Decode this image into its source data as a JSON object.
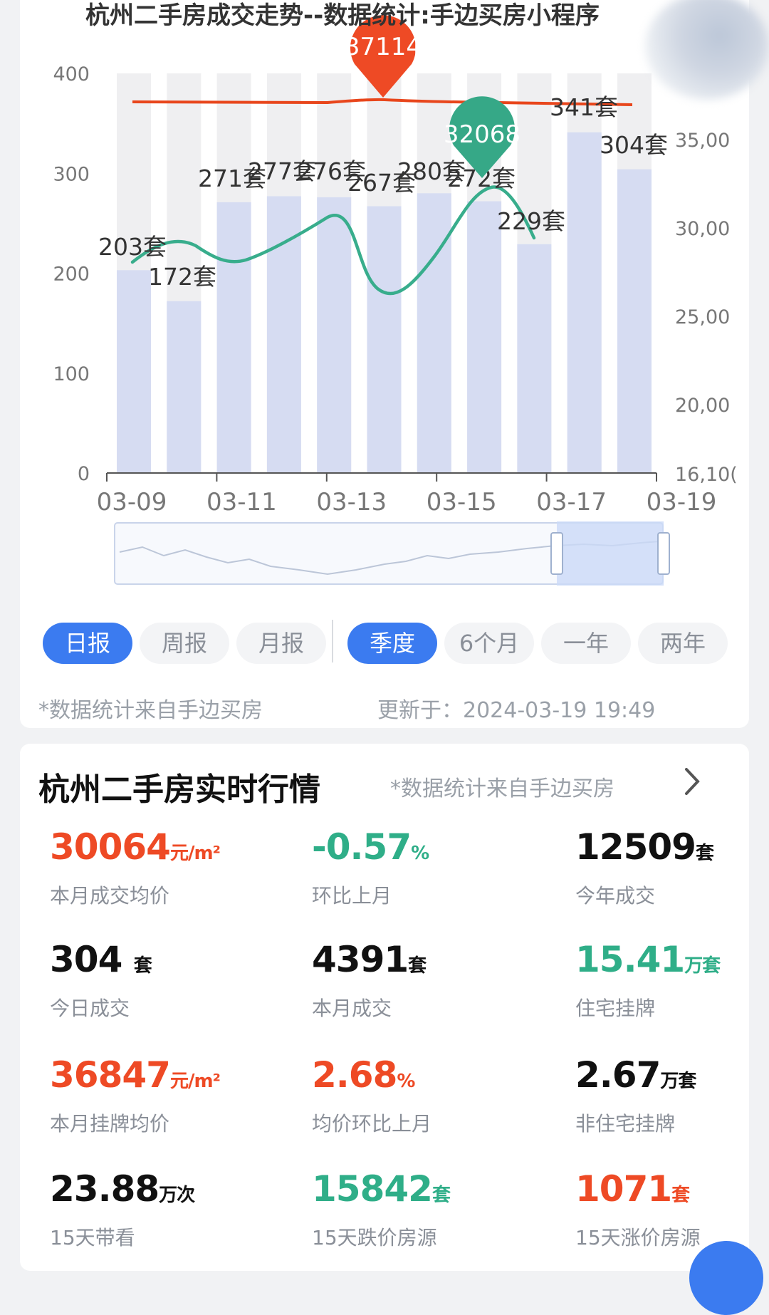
{
  "chart": {
    "title": "杭州二手房成交走势--数据统计:手边买房小程序",
    "left_ticks": [
      "400",
      "300",
      "200",
      "100",
      "0"
    ],
    "right_ticks": [
      "35,00",
      "30,00",
      "25,00",
      "20,00",
      "16,10("
    ],
    "x_ticks": [
      "03-09",
      "03-11",
      "03-13",
      "03-15",
      "03-17",
      "03-19"
    ]
  },
  "chart_data": {
    "type": "bar",
    "categories": [
      "03-09",
      "03-10",
      "03-11",
      "03-12",
      "03-13",
      "03-14",
      "03-15",
      "03-16",
      "03-17",
      "03-18",
      "03-19"
    ],
    "series": [
      {
        "values": [
          203,
          172,
          271,
          277,
          276,
          267,
          280,
          272,
          229,
          341,
          304
        ],
        "labels": [
          "203套",
          "172套",
          "271套",
          "277套",
          "276套",
          "267套",
          "280套",
          "272套",
          "229套",
          "341套",
          "304套"
        ]
      }
    ],
    "line_markers": {
      "max": "37114",
      "min": "32068"
    },
    "ylim": [
      0,
      400
    ],
    "colors": {
      "bar": "#d6dcf2",
      "bar_bg": "#efeff1",
      "red_line": "#e8461c",
      "green_line": "#38ad8c",
      "max_pin": "#ee4a25",
      "min_pin": "#36a887"
    }
  },
  "tabs": [
    "日报",
    "周报",
    "月报",
    "季度",
    "6个月",
    "一年",
    "两年"
  ],
  "note_left": "*数据统计来自手边买房",
  "note_right": "更新于：2024-03-19 19:49",
  "section": {
    "title": "杭州二手房实时行情",
    "note": "*数据统计来自手边买房"
  },
  "stats": [
    {
      "value": "30064",
      "unit": "元/m²",
      "label": "本月成交均价",
      "color": "red"
    },
    {
      "value": "-0.57",
      "unit": "%",
      "label": "环比上月",
      "color": "green"
    },
    {
      "value": "12509",
      "unit": "套",
      "label": "今年成交",
      "color": "black"
    },
    {
      "value": "304 ",
      "unit": "套",
      "label": "今日成交",
      "color": "black"
    },
    {
      "value": "4391",
      "unit": "套",
      "label": "本月成交",
      "color": "black"
    },
    {
      "value": "15.41",
      "unit": "万套",
      "label": "住宅挂牌",
      "color": "green"
    },
    {
      "value": "36847",
      "unit": "元/m²",
      "label": "本月挂牌均价",
      "color": "red"
    },
    {
      "value": "2.68",
      "unit": "%",
      "label": "均价环比上月",
      "color": "red"
    },
    {
      "value": "2.67",
      "unit": "万套",
      "label": "非住宅挂牌",
      "color": "black"
    },
    {
      "value": "23.88",
      "unit": "万次",
      "label": "15天带看",
      "color": "black"
    },
    {
      "value": "15842",
      "unit": "套",
      "label": "15天跌价房源",
      "color": "green"
    },
    {
      "value": "1071",
      "unit": "套",
      "label": "15天涨价房源",
      "color": "red"
    }
  ]
}
